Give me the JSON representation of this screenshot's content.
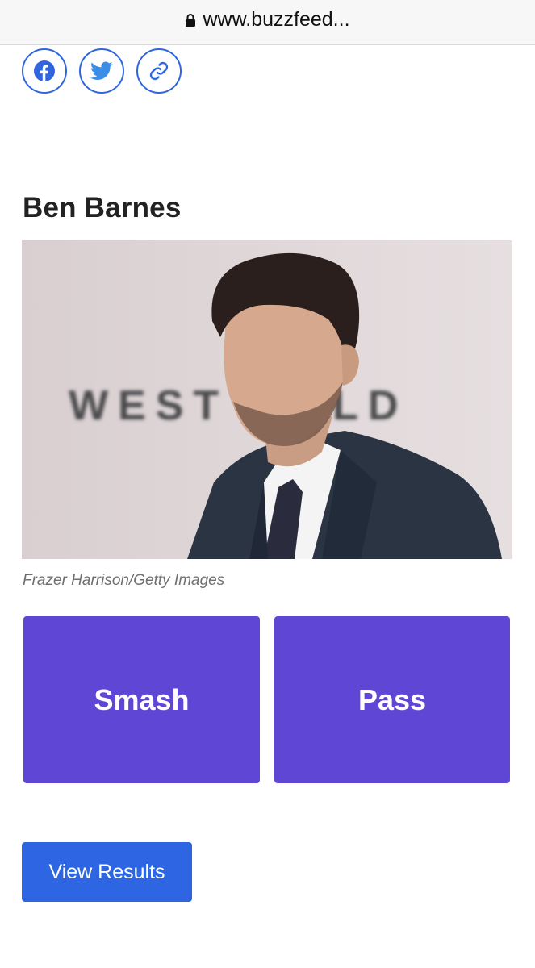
{
  "browser": {
    "url": "www.buzzfeed..."
  },
  "share": {
    "icons": [
      "facebook-icon",
      "twitter-icon",
      "link-icon"
    ]
  },
  "item": {
    "title": "Ben Barnes",
    "photo_backdrop_text": "WEST   RLD",
    "photo_credit": "Frazer Harrison/Getty Images"
  },
  "answers": {
    "smash_label": "Smash",
    "pass_label": "Pass"
  },
  "results": {
    "button_label": "View Results"
  },
  "colors": {
    "answer_bg": "#6046d4",
    "button_blue": "#2d65e2",
    "share_blue": "#2f66e0"
  }
}
